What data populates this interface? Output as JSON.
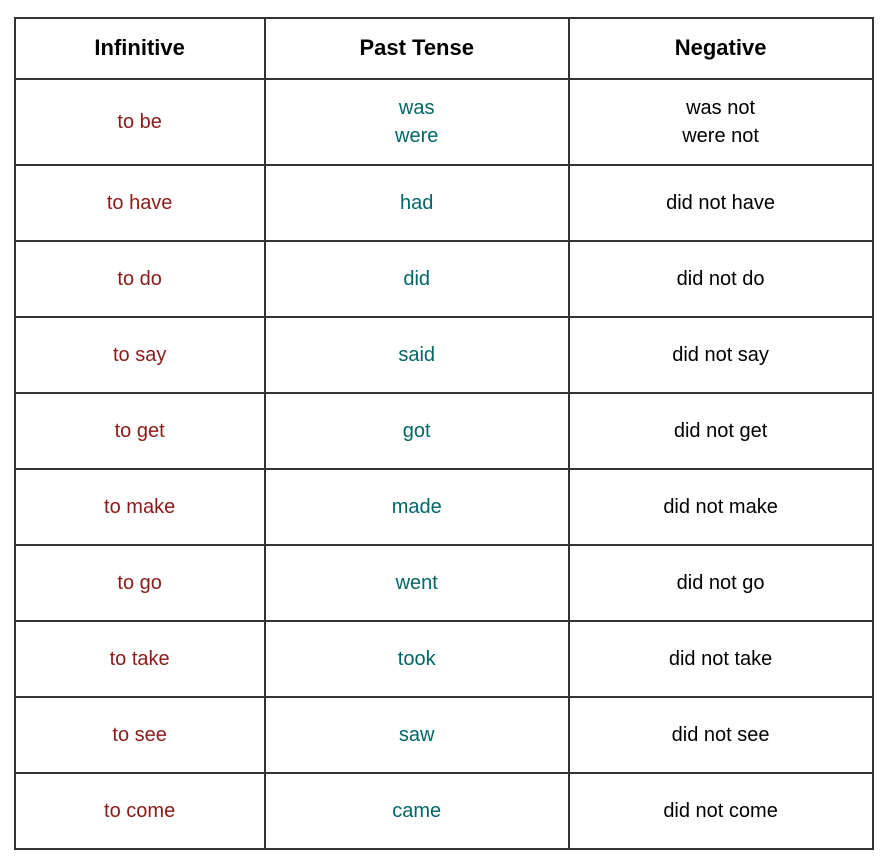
{
  "table": {
    "headers": {
      "col1": "Infinitive",
      "col2": "Past Tense",
      "col3": "Negative"
    },
    "rows": [
      {
        "infinitive": "to be",
        "past_tense": "was\nwere",
        "negative": "was not\nwere not"
      },
      {
        "infinitive": "to have",
        "past_tense": "had",
        "negative": "did not have"
      },
      {
        "infinitive": "to do",
        "past_tense": "did",
        "negative": "did not do"
      },
      {
        "infinitive": "to say",
        "past_tense": "said",
        "negative": "did not say"
      },
      {
        "infinitive": "to get",
        "past_tense": "got",
        "negative": "did not get"
      },
      {
        "infinitive": "to make",
        "past_tense": "made",
        "negative": "did not make"
      },
      {
        "infinitive": "to go",
        "past_tense": "went",
        "negative": "did not go"
      },
      {
        "infinitive": "to take",
        "past_tense": "took",
        "negative": "did not take"
      },
      {
        "infinitive": "to see",
        "past_tense": "saw",
        "negative": "did not see"
      },
      {
        "infinitive": "to come",
        "past_tense": "came",
        "negative": "did not come"
      }
    ]
  }
}
